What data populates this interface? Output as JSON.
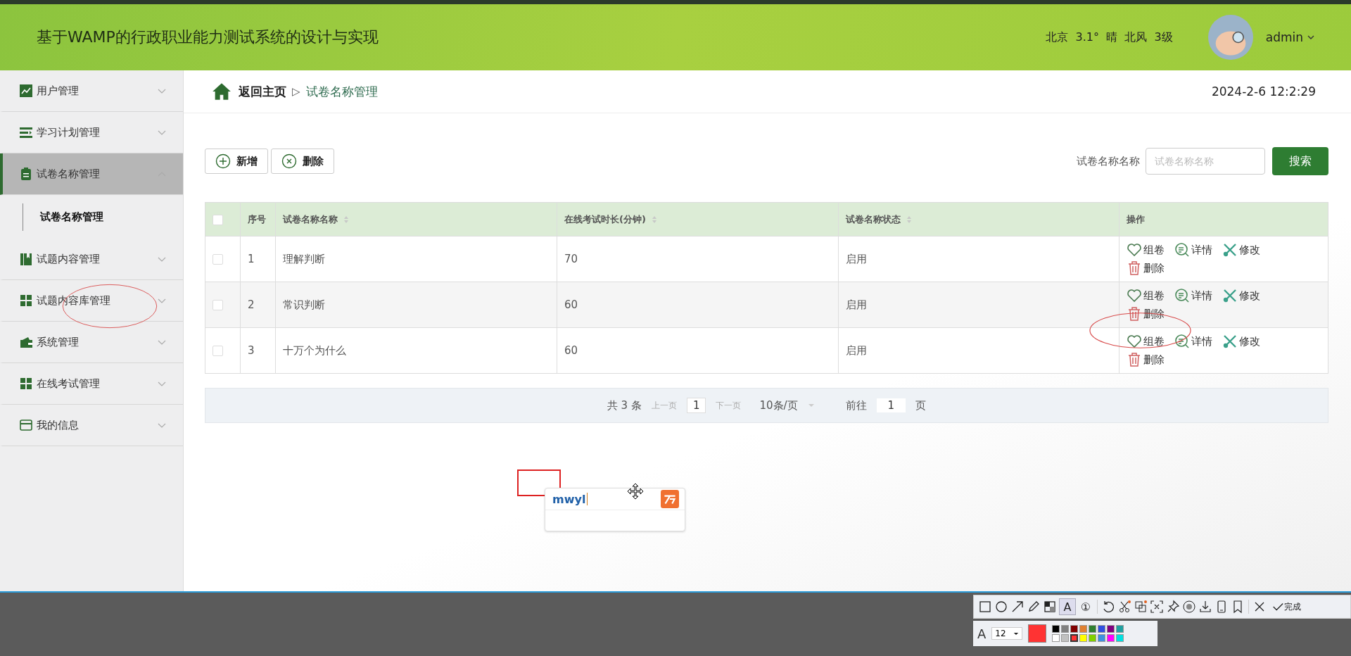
{
  "header": {
    "title": "基于WAMP的行政职业能力测试系统的设计与实现",
    "weather": "北京  3.1°  晴  北风  3级",
    "user": "admin"
  },
  "sidebar": {
    "items": [
      {
        "label": "用户管理",
        "selected": false,
        "expanded": false
      },
      {
        "label": "学习计划管理",
        "selected": false,
        "expanded": false
      },
      {
        "label": "试卷名称管理",
        "selected": true,
        "expanded": true,
        "children": [
          {
            "label": "试卷名称管理",
            "selected": true
          }
        ]
      },
      {
        "label": "试题内容管理",
        "selected": false,
        "expanded": false
      },
      {
        "label": "试题内容库管理",
        "selected": false,
        "expanded": false
      },
      {
        "label": "系统管理",
        "selected": false,
        "expanded": false
      },
      {
        "label": "在线考试管理",
        "selected": false,
        "expanded": false
      },
      {
        "label": "我的信息",
        "selected": false,
        "expanded": false
      }
    ]
  },
  "breadcrumb": {
    "home": "返回主页",
    "separator": "▷",
    "current": "试卷名称管理"
  },
  "datetime": "2024-2-6 12:2:29",
  "toolbar": {
    "buttons": [
      {
        "label": "新增",
        "kind": "add"
      },
      {
        "label": "删除",
        "kind": "delete"
      }
    ],
    "search_label": "试卷名称名称",
    "search": {
      "placeholder": "试卷名称名称"
    },
    "search_button": "搜索"
  },
  "table": {
    "select_all": {
      "checked": false
    },
    "columns": [
      {
        "label": "序号",
        "sortable": false
      },
      {
        "label": "试卷名称名称",
        "sortable": true
      },
      {
        "label": "在线考试时长(分钟)",
        "sortable": true
      },
      {
        "label": "试卷名称状态",
        "sortable": true
      },
      {
        "label": "操作",
        "sortable": false
      }
    ],
    "rows": [
      {
        "checked": false,
        "cells": [
          "1",
          "理解判断",
          "70",
          "启用"
        ],
        "actions": [
          {
            "label": "组卷",
            "kind": "compose"
          },
          {
            "label": "详情",
            "kind": "detail"
          },
          {
            "label": "修改",
            "kind": "edit"
          },
          {
            "label": "删除",
            "kind": "delete"
          }
        ]
      },
      {
        "checked": false,
        "cells": [
          "2",
          "常识判断",
          "60",
          "启用"
        ],
        "actions": [
          {
            "label": "组卷",
            "kind": "compose"
          },
          {
            "label": "详情",
            "kind": "detail"
          },
          {
            "label": "修改",
            "kind": "edit"
          },
          {
            "label": "删除",
            "kind": "delete"
          }
        ]
      },
      {
        "checked": false,
        "cells": [
          "3",
          "十万个为什么",
          "60",
          "启用"
        ],
        "actions": [
          {
            "label": "组卷",
            "kind": "compose"
          },
          {
            "label": "详情",
            "kind": "detail"
          },
          {
            "label": "修改",
            "kind": "edit"
          },
          {
            "label": "删除",
            "kind": "delete"
          }
        ]
      }
    ]
  },
  "pagination": {
    "total": "共 3 条",
    "prev": "上一页",
    "page": "1",
    "next": "下一页",
    "page_size": "10条/页",
    "goto": "前往",
    "goto_value": "1",
    "page_unit": "页"
  },
  "ime": {
    "text": "mwyl"
  },
  "capture_toolbar": {
    "text_tool": "A",
    "number_tool": "①",
    "done": "完成",
    "font_label": "A",
    "font_size": "12",
    "palette": [
      {
        "color": "#000000",
        "selected": false
      },
      {
        "color": "#808080",
        "selected": false
      },
      {
        "color": "#800000",
        "selected": false
      },
      {
        "color": "#e08030",
        "selected": false
      },
      {
        "color": "#308030",
        "selected": false
      },
      {
        "color": "#3050e0",
        "selected": false
      },
      {
        "color": "#800080",
        "selected": false
      },
      {
        "color": "#20a0a0",
        "selected": false
      },
      {
        "color": "#ffffff",
        "selected": false
      },
      {
        "color": "#c0c0c0",
        "selected": false
      },
      {
        "color": "#ff3333",
        "selected": true
      },
      {
        "color": "#ffff00",
        "selected": false
      },
      {
        "color": "#80d000",
        "selected": false
      },
      {
        "color": "#4090e0",
        "selected": false
      },
      {
        "color": "#ff00ff",
        "selected": false
      },
      {
        "color": "#00e0e0",
        "selected": false
      }
    ]
  }
}
